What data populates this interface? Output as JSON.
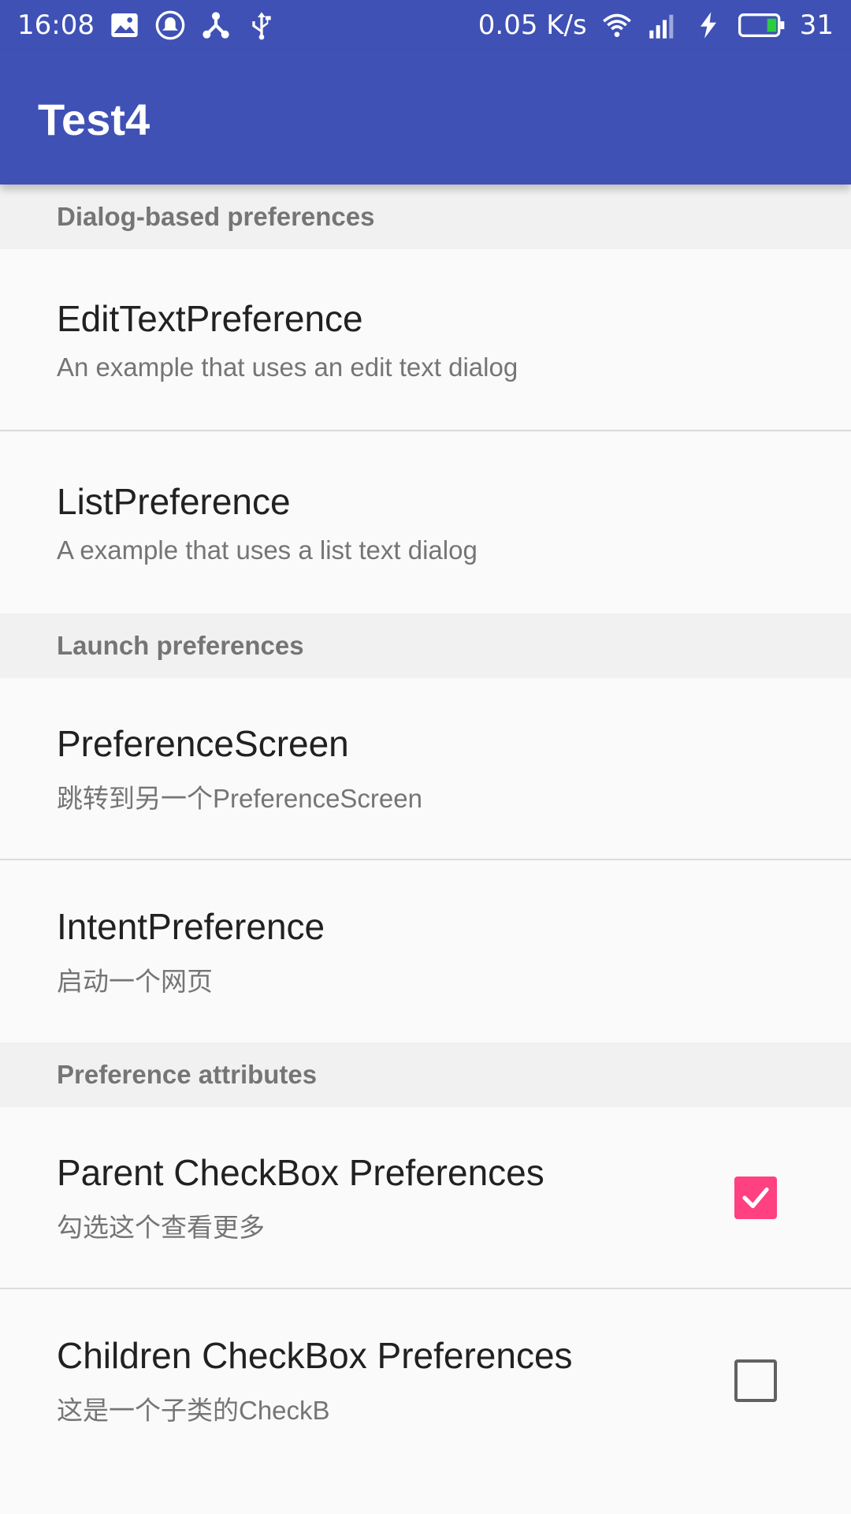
{
  "status_bar": {
    "time": "16:08",
    "speed": "0.05 K/s",
    "battery": "31",
    "icons": [
      "image-icon",
      "notification-bell-icon",
      "share-icon",
      "usb-icon",
      "wifi-icon",
      "signal-4g-icon",
      "charging-icon",
      "battery-icon"
    ]
  },
  "app_bar": {
    "title": "Test4"
  },
  "colors": {
    "primary": "#3f51b5",
    "accent": "#ff4081",
    "category_bg": "#f1f1f1",
    "category_text": "#757575"
  },
  "sections": [
    {
      "header": "Dialog-based preferences",
      "items": [
        {
          "title": "EditTextPreference",
          "summary": "An example that uses an edit text dialog"
        },
        {
          "title": "ListPreference",
          "summary": "A example that uses a list text dialog"
        }
      ]
    },
    {
      "header": "Launch preferences",
      "items": [
        {
          "title": "PreferenceScreen",
          "summary": "跳转到另一个PreferenceScreen"
        },
        {
          "title": "IntentPreference",
          "summary": "启动一个网页"
        }
      ]
    },
    {
      "header": "Preference attributes",
      "items": [
        {
          "title": "Parent CheckBox Preferences",
          "summary": "勾选这个查看更多",
          "checked": true
        },
        {
          "title": "Children CheckBox Preferences",
          "summary": "这是一个子类的CheckB",
          "checked": false
        }
      ]
    }
  ]
}
